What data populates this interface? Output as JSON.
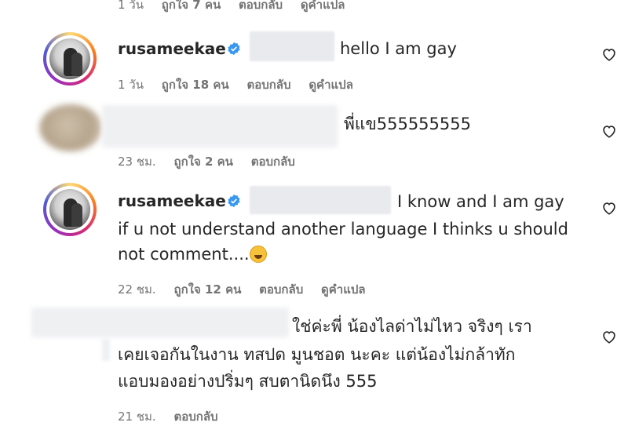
{
  "top_meta": {
    "time": "1 วัน",
    "likes": "ถูกใจ 7 คน",
    "reply": "ตอบกลับ",
    "translate": "ดูคำแปล"
  },
  "comments": [
    {
      "username": "rusameekae",
      "text": "hello I am gay",
      "time": "1 วัน",
      "likes": "ถูกใจ 18 คน",
      "reply": "ตอบกลับ",
      "translate": "ดูคำแปล"
    },
    {
      "text": "พี่แข555555555",
      "time": "23 ชม.",
      "likes": "ถูกใจ 2 คน",
      "reply": "ตอบกลับ"
    },
    {
      "username": "rusameekae",
      "text_line1": "I know and I am gay",
      "text_line2": "if u not understand another language I thinks u should",
      "text_line3": "not comment....",
      "emoji": "rolling-on-floor-laughing",
      "time": "22 ชม.",
      "likes": "ถูกใจ 12 คน",
      "reply": "ตอบกลับ",
      "translate": "ดูคำแปล"
    },
    {
      "text_line1": "ใช่ค่ะพี่ น้องไลด่าไม่ไหว จริงๆ เรา",
      "text_line2": "เคยเจอกันในงาน ทสปด มูนชอต นะคะ แต่น้องไม่กล้าทัก",
      "text_line3": "แอบมองอย่างปริ่มๆ สบตานิดนึง 555",
      "time": "21 ชม.",
      "reply": "ตอบกลับ"
    }
  ],
  "icons": {
    "like": "heart-outline-icon",
    "verified": "verified-badge-icon"
  },
  "colors": {
    "verified": "#3897f0",
    "meta": "#737373",
    "text": "#262626"
  }
}
